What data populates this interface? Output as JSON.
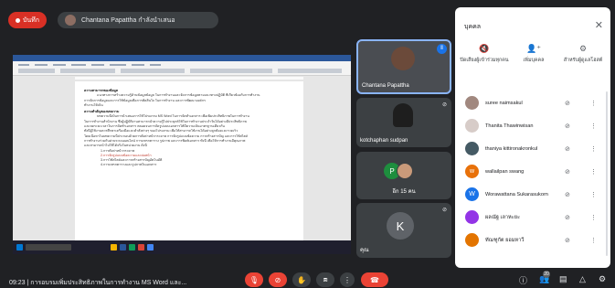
{
  "top_bar": {
    "record_label": "บันทึก",
    "presenter_label": "Chantana Papattha กำลังนำเสนอ"
  },
  "document": {
    "lines": [
      {
        "text": "ความสามารถของข้อมูล",
        "style": "h"
      },
      {
        "text": "        แนวทางการสร้างความรู้ด้านข้อมูลข้อมูล ในการทำงานและจัดการข้อมูลตามแนวทางปฏิบัติ ที่เกี่ยวข้องกับการทำงาน",
        "style": "ind"
      },
      {
        "text": "การจัดการข้อมูลและการใช้ข้อมูลเพื่อการตัดสินใจ ในการทำงาน และการพัฒนาองค์กร",
        "style": ""
      },
      {
        "text": "ทำงานให้เป็น",
        "style": ""
      },
      {
        "text": "ความสำคัญของบทความ",
        "style": "h"
      },
      {
        "text": "        บทความนี้เป็นการนำเสนอการใช้โปรแกรม MS Word ในการจัดทำเอกสาร เพื่อเพิ่มประสิทธิภาพในการทำงาน",
        "style": "ind"
      },
      {
        "text": "ในการทำงานสำนักงาน ซึ่งผู้ปฏิบัติงานสามารถนำความรู้ไปประยุกต์ใช้ในการทำงานประจำวันได้อย่างมีประสิทธิภาพ",
        "style": ""
      },
      {
        "text": "และลดระยะเวลาในการจัดทำเอกสาร ตลอดจนการจัดรูปแบบเอกสารให้มีความเป็นมาตรฐานเดียวกัน",
        "style": ""
      },
      {
        "text": "ทั้งนี้ผู้ใช้งานควรศึกษาเครื่องมือและคำสั่งต่างๆ ของโปรแกรม เพื่อให้สามารถใช้งานได้อย่างถูกต้องและรวดเร็ว",
        "style": ""
      },
      {
        "text": "โดยเนื้อหาในบทความนี้ประกอบด้วยการตั้งค่าหน้ากระดาษ การจัดรูปแบบข้อความ การสร้างสารบัญ และการใช้สไตล์",
        "style": ""
      },
      {
        "text": "การทำงานร่วมกันผ่านระบบออนไลน์ การแทรกตาราง รูปภาพ และการพิมพ์เอกสาร ทั้งนี้ เพื่อให้การทำงานมีคุณภาพ",
        "style": ""
      },
      {
        "text": "และสามารถนำไปใช้ได้จริงในหน่วยงาน ดังนี้",
        "style": ""
      },
      {
        "text": "1.การตั้งค่าหน้ากระดาษ",
        "style": "list"
      },
      {
        "text": "2.การจัดรูปแบบข้อความและย่อหน้า",
        "style": "list red"
      },
      {
        "text": "3.การใช้สไตล์และการสร้างสารบัญอัตโนมัติ",
        "style": "list"
      },
      {
        "text": "4.การแทรกตารางและรูปภาพในเอกสาร",
        "style": "list"
      }
    ]
  },
  "tiles": {
    "main_name": "Chantana Papattha",
    "second_name": "kotchaphan sudpan",
    "more_label": "อีก 15 คน",
    "initial_k": "K",
    "k_name": "คุณ",
    "initial_p": "P"
  },
  "panel": {
    "title": "บุคคล",
    "actions": [
      {
        "label": "ปิดเสียงผู้เข้าร่วมทุกคน",
        "icon": "mute-all-icon"
      },
      {
        "label": "เพิ่มบุคคล",
        "icon": "add-person-icon"
      },
      {
        "label": "สำหรับผู้ดูแลโฮสต์",
        "icon": "host-controls-icon"
      }
    ],
    "people": [
      {
        "name": "suree naimsakul",
        "initial": "",
        "color": "#a1887f"
      },
      {
        "name": "Thanita Thawinwisan",
        "initial": "",
        "color": "#d7ccc8"
      },
      {
        "name": "thaniya kittironakronkul",
        "initial": "",
        "color": "#455a64"
      },
      {
        "name": "wallailpan swang",
        "initial": "w",
        "color": "#e8710a"
      },
      {
        "name": "Worawattana Sukarasukorn",
        "initial": "W",
        "color": "#1a73e8"
      },
      {
        "name": "ผลณัฐ เลาหะยะ",
        "initial": "",
        "color": "#9334e6"
      },
      {
        "name": "ทัณฑูกัต ยอมหาวี",
        "initial": "",
        "color": "#e37400"
      }
    ]
  },
  "bottom_bar": {
    "time": "09:23",
    "meeting_title": "การอบรมเพิ่มประสิทธิภาพในการทำงาน MS Word และ...",
    "participant_count": "20"
  },
  "colors": {
    "record": "#d93025",
    "end_call": "#ea4335",
    "active_speaker": "#1a73e8"
  }
}
